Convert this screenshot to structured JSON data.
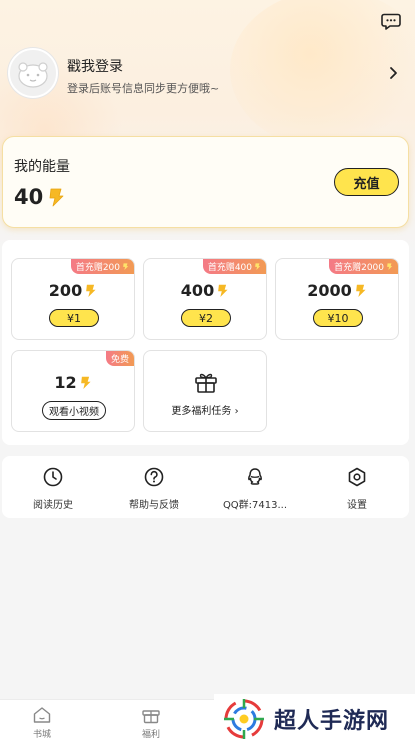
{
  "colors": {
    "accent_yellow": "#ffe44d",
    "badge_gradient_start": "#f47a86",
    "badge_gradient_end": "#f29a54",
    "energy_card_border": "#f5dfa3",
    "coin_yellow": "#f6b824"
  },
  "header": {
    "message_icon": "chat-bubble-icon",
    "login_title": "戳我登录",
    "login_subtitle": "登录后账号信息同步更方便哦~"
  },
  "energy": {
    "title": "我的能量",
    "value": "40",
    "recharge_label": "充值"
  },
  "rewards": {
    "packages": [
      {
        "badge": "首充赠200",
        "amount": "200",
        "price": "¥1"
      },
      {
        "badge": "首充赠400",
        "amount": "400",
        "price": "¥2"
      },
      {
        "badge": "首充赠2000",
        "amount": "2000",
        "price": "¥10"
      }
    ],
    "free_tile": {
      "badge": "免费",
      "amount": "12",
      "action_label": "观看小视频"
    },
    "more_tasks_label": "更多福利任务 ›"
  },
  "tools": [
    {
      "label": "阅读历史",
      "icon": "history-clock-icon"
    },
    {
      "label": "帮助与反馈",
      "icon": "help-question-icon"
    },
    {
      "label": "QQ群:7413...",
      "icon": "qq-penguin-icon"
    },
    {
      "label": "设置",
      "icon": "settings-hexagon-icon"
    }
  ],
  "bottom_nav": [
    {
      "label": "书城",
      "icon": "home-icon"
    },
    {
      "label": "福利",
      "icon": "gift-icon"
    }
  ],
  "watermark": {
    "text": "超人手游网"
  }
}
